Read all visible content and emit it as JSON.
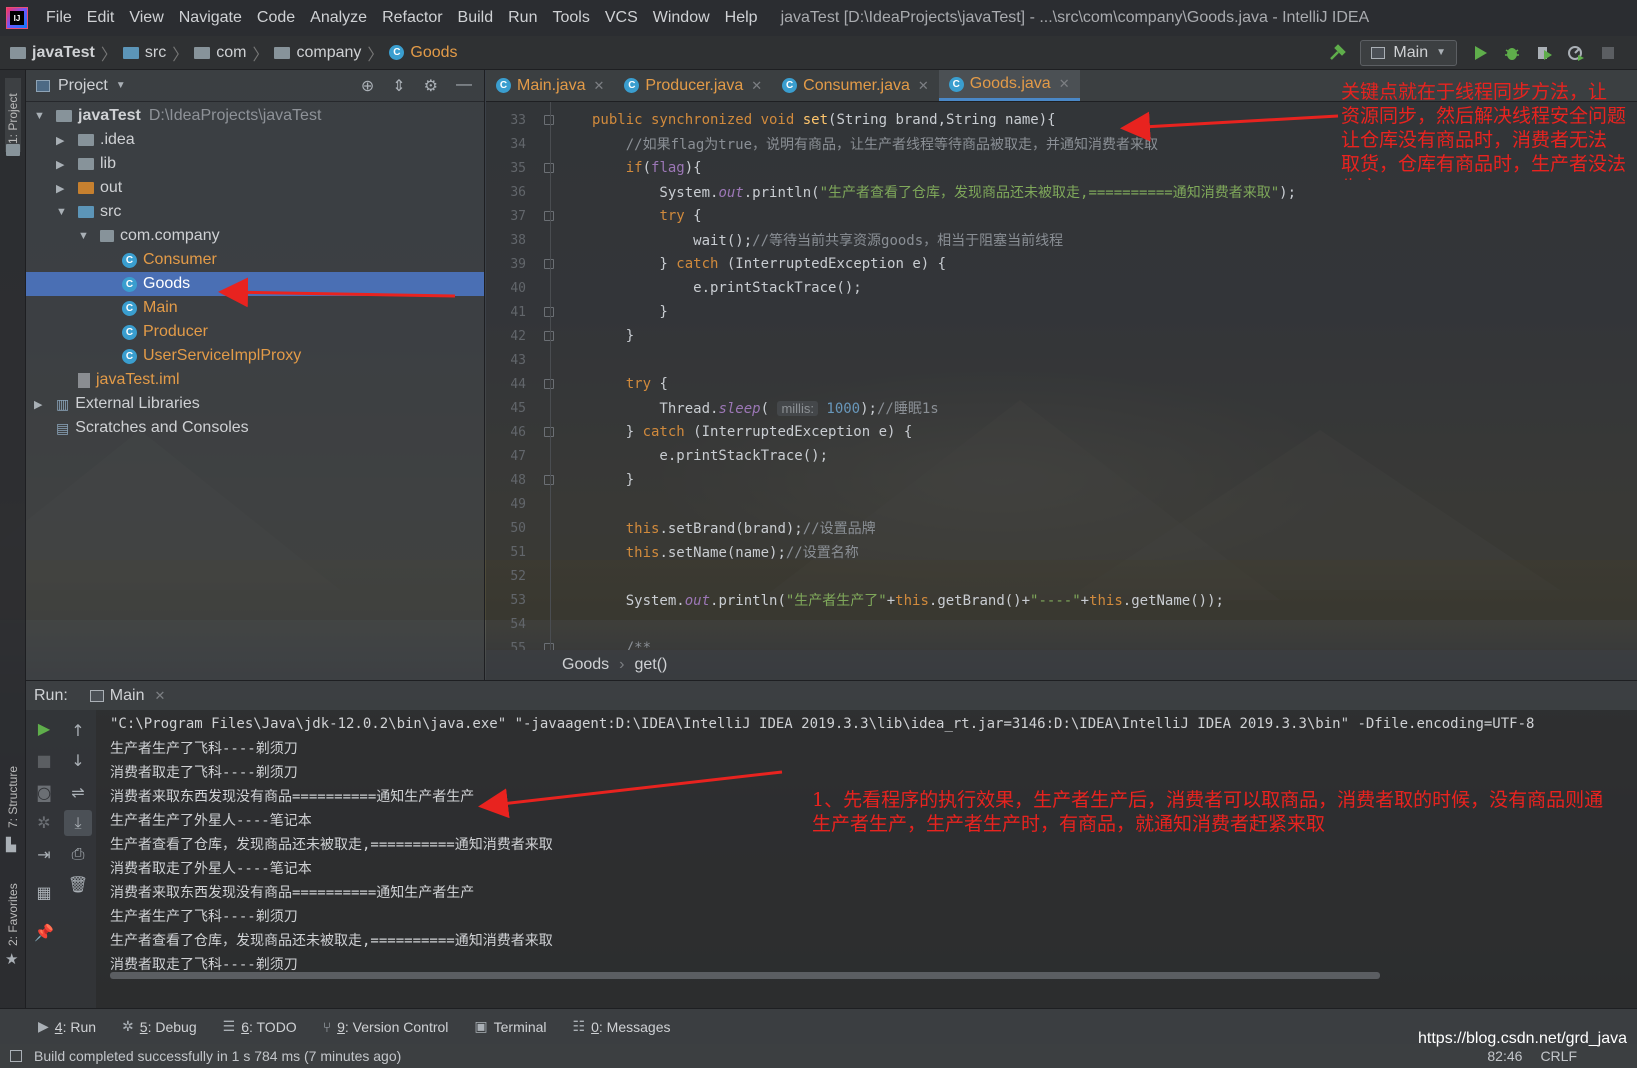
{
  "app": {
    "window_title": "javaTest [D:\\IdeaProjects\\javaTest] - ...\\src\\com\\company\\Goods.java - IntelliJ IDEA",
    "menu": [
      "File",
      "Edit",
      "View",
      "Navigate",
      "Code",
      "Analyze",
      "Refactor",
      "Build",
      "Run",
      "Tools",
      "VCS",
      "Window",
      "Help"
    ]
  },
  "navbar": {
    "breadcrumbs": [
      "javaTest",
      "src",
      "com",
      "company",
      "Goods"
    ],
    "run_config": "Main"
  },
  "left_strip": {
    "project_tab": "1: Project",
    "structure_tab": "7: Structure",
    "favorites_tab": "2: Favorites"
  },
  "project": {
    "title": "Project",
    "tree": [
      {
        "label": "javaTest",
        "hint": "D:\\IdeaProjects\\javaTest",
        "depth": 0,
        "arrow": "▼",
        "icon": "folder"
      },
      {
        "label": ".idea",
        "depth": 1,
        "arrow": "▶",
        "icon": "folder"
      },
      {
        "label": "lib",
        "depth": 1,
        "arrow": "▶",
        "icon": "folder"
      },
      {
        "label": "out",
        "depth": 1,
        "arrow": "▶",
        "icon": "folder-orange"
      },
      {
        "label": "src",
        "depth": 1,
        "arrow": "▼",
        "icon": "folder-blue"
      },
      {
        "label": "com.company",
        "depth": 2,
        "arrow": "▼",
        "icon": "package"
      },
      {
        "label": "Consumer",
        "depth": 3,
        "arrow": "",
        "icon": "class"
      },
      {
        "label": "Goods",
        "depth": 3,
        "arrow": "",
        "icon": "class",
        "selected": true
      },
      {
        "label": "Main",
        "depth": 3,
        "arrow": "",
        "icon": "class"
      },
      {
        "label": "Producer",
        "depth": 3,
        "arrow": "",
        "icon": "class"
      },
      {
        "label": "UserServiceImplProxy",
        "depth": 3,
        "arrow": "",
        "icon": "class"
      },
      {
        "label": "javaTest.iml",
        "depth": 1,
        "arrow": "",
        "icon": "iml"
      },
      {
        "label": "External Libraries",
        "depth": 0,
        "arrow": "▶",
        "icon": "libs"
      },
      {
        "label": "Scratches and Consoles",
        "depth": 0,
        "arrow": "",
        "icon": "scratch"
      }
    ]
  },
  "editor_tabs": [
    {
      "label": "Main.java",
      "active": false
    },
    {
      "label": "Producer.java",
      "active": false
    },
    {
      "label": "Consumer.java",
      "active": false
    },
    {
      "label": "Goods.java",
      "active": true
    }
  ],
  "editor": {
    "lines": [
      {
        "n": "33",
        "html": "<span class='kw'>public synchronized void </span><span class='fn'>set</span>(String brand,String name){"
      },
      {
        "n": "34",
        "html": "    <span class='cm'>//如果flag为true，说明有商品，让生产者线程等待商品被取走，并通知消费者来取</span>"
      },
      {
        "n": "35",
        "html": "    <span class='kw'>if</span>(<span class='fld' style='font-style:normal'>flag</span>){"
      },
      {
        "n": "36",
        "html": "        System.<span class='fld'>out</span>.println(<span class='str'>\"生产者查看了仓库，发现商品还未被取走,==========通知消费者来取\"</span>);"
      },
      {
        "n": "37",
        "html": "        <span class='kw'>try</span> {"
      },
      {
        "n": "38",
        "html": "            wait();<span class='cm'>//等待当前共享资源goods，相当于阻塞当前线程</span>"
      },
      {
        "n": "39",
        "html": "        } <span class='kw'>catch</span> (InterruptedException e) {"
      },
      {
        "n": "40",
        "html": "            e.printStackTrace();"
      },
      {
        "n": "41",
        "html": "        }"
      },
      {
        "n": "42",
        "html": "    }"
      },
      {
        "n": "43",
        "html": ""
      },
      {
        "n": "44",
        "html": "    <span class='kw'>try</span> {"
      },
      {
        "n": "45",
        "html": "        Thread.<span class='fld'>sleep</span>( <span class='hint'>millis:</span> <span class='num'>1000</span>);<span class='cm'>//睡眠1s</span>"
      },
      {
        "n": "46",
        "html": "    } <span class='kw'>catch</span> (InterruptedException e) {"
      },
      {
        "n": "47",
        "html": "        e.printStackTrace();"
      },
      {
        "n": "48",
        "html": "    }"
      },
      {
        "n": "49",
        "html": ""
      },
      {
        "n": "50",
        "html": "    <span class='kw'>this</span>.setBrand(brand);<span class='cm'>//设置品牌</span>"
      },
      {
        "n": "51",
        "html": "    <span class='kw'>this</span>.setName(name);<span class='cm'>//设置名称</span>"
      },
      {
        "n": "52",
        "html": ""
      },
      {
        "n": "53",
        "html": "    System.<span class='fld'>out</span>.println(<span class='str'>\"生产者生产了\"</span>+<span class='kw'>this</span>.getBrand()+<span class='str'>\"----\"</span>+<span class='kw'>this</span>.getName());"
      },
      {
        "n": "54",
        "html": ""
      },
      {
        "n": "55",
        "html": "    <span class='cm'>/**</span>"
      }
    ],
    "breadcrumb": [
      "Goods",
      "get()"
    ]
  },
  "run_panel": {
    "label": "Run:",
    "tab": "Main",
    "console": [
      "\"C:\\Program Files\\Java\\jdk-12.0.2\\bin\\java.exe\" \"-javaagent:D:\\IDEA\\IntelliJ IDEA 2019.3.3\\lib\\idea_rt.jar=3146:D:\\IDEA\\IntelliJ IDEA 2019.3.3\\bin\" -Dfile.encoding=UTF-8",
      "生产者生产了飞科----剃须刀",
      "消费者取走了飞科----剃须刀",
      "消费者来取东西发现没有商品==========通知生产者生产",
      "生产者生产了外星人----笔记本",
      "生产者查看了仓库，发现商品还未被取走,==========通知消费者来取",
      "消费者取走了外星人----笔记本",
      "消费者来取东西发现没有商品==========通知生产者生产",
      "生产者生产了飞科----剃须刀",
      "生产者查看了仓库，发现商品还未被取走,==========通知消费者来取",
      "消费者取走了飞科----剃须刀"
    ]
  },
  "tool_tabs": [
    {
      "num": "4",
      "label": ": Run"
    },
    {
      "num": "5",
      "label": ": Debug"
    },
    {
      "num": "6",
      "label": ": TODO"
    },
    {
      "num": "9",
      "label": ": Version Control"
    },
    {
      "num": "",
      "label": "Terminal"
    },
    {
      "num": "0",
      "label": ": Messages"
    }
  ],
  "status": {
    "message": "Build completed successfully in 1 s 784 ms (7 minutes ago)",
    "position": "82:46",
    "line_sep": "CRLF"
  },
  "watermark": "https://blog.csdn.net/grd_java",
  "annotations": {
    "top_right": [
      "关键点就在于线程同步方法，让",
      "资源同步，然后解决线程安全问题",
      "让仓库没有商品时，消费者无法",
      "取货，仓库有商品时，生产者没法",
      "生产"
    ],
    "console_note": [
      "1、先看程序的执行效果，生产者生产后，消费者可以取商品，消费者取的时候，没有商品则通",
      "生产者生产，生产者生产时，有商品，就通知消费者赶紧来取"
    ]
  },
  "colors": {
    "accent": "#4a88c7",
    "selection": "#4a6fb4",
    "annotation_red": "#e8231f",
    "class_orange": "#e39b48"
  }
}
